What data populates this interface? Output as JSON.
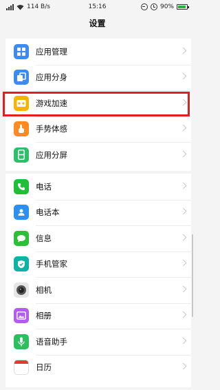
{
  "status_bar": {
    "network_speed": "114 B/s",
    "time": "15:16",
    "battery_percent": "90%",
    "icons": [
      "signal-icon",
      "wifi-icon",
      "dnd-icon",
      "alarm-icon",
      "battery-icon"
    ]
  },
  "header": {
    "title": "设置"
  },
  "groups": [
    {
      "items": [
        {
          "label": "应用管理",
          "icon": "app-manage-icon",
          "color": "#3d8bf2"
        },
        {
          "label": "应用分身",
          "icon": "app-clone-icon",
          "color": "#3d8bf2"
        },
        {
          "label": "游戏加速",
          "icon": "game-boost-icon",
          "color": "#f5b400"
        },
        {
          "label": "手势体感",
          "icon": "gesture-icon",
          "color": "#ff8a1f"
        },
        {
          "label": "应用分屏",
          "icon": "split-screen-icon",
          "color": "#2ebf6a"
        }
      ]
    },
    {
      "items": [
        {
          "label": "电话",
          "icon": "phone-icon",
          "color": "#1fbf3a"
        },
        {
          "label": "电话本",
          "icon": "contacts-icon",
          "color": "#2d8ff0"
        },
        {
          "label": "信息",
          "icon": "messages-icon",
          "color": "#2cbf37"
        },
        {
          "label": "手机管家",
          "icon": "phone-manager-icon",
          "color": "#0fb3a4"
        },
        {
          "label": "相机",
          "icon": "camera-icon",
          "color": "#555555"
        },
        {
          "label": "相册",
          "icon": "gallery-icon",
          "color": "#b25cf2"
        },
        {
          "label": "语音助手",
          "icon": "voice-assistant-icon",
          "color": "#2cbf5f"
        },
        {
          "label": "日历",
          "icon": "calendar-icon",
          "color": "#ffffff"
        }
      ]
    }
  ],
  "highlighted_item": "游戏加速"
}
